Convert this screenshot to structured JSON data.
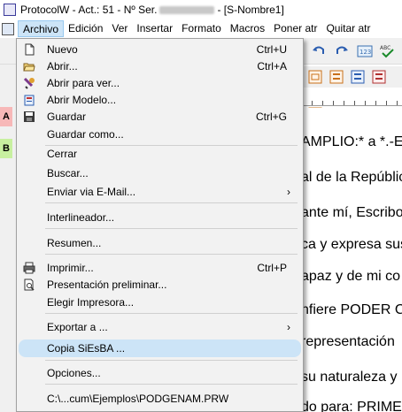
{
  "window": {
    "title_prefix": "ProtocolW - Act.: 51 - Nº Ser.",
    "title_suffix": "- [S-Nombre1]"
  },
  "menubar": {
    "items": [
      "Archivo",
      "Edición",
      "Ver",
      "Insertar",
      "Formato",
      "Macros",
      "Poner atr",
      "Quitar atr"
    ]
  },
  "left_strip": {
    "cells": [
      "A",
      "B"
    ]
  },
  "document": {
    "lines": [
      "AMPLIO:* a *.-E",
      "al de la Repúblic",
      "ante mí, Escribo",
      "ca y expresa sus",
      "apaz y de mi co",
      "nfiere PODER C",
      "representación",
      "su naturaleza y l",
      "do para: PRIME"
    ]
  },
  "file_menu": {
    "items": [
      {
        "label": "Nuevo",
        "shortcut": "Ctrl+U",
        "icon": "new-document-icon"
      },
      {
        "label": "Abrir...",
        "shortcut": "Ctrl+A",
        "icon": "open-folder-icon"
      },
      {
        "label": "Abrir para ver...",
        "shortcut": "",
        "icon": "view-icon"
      },
      {
        "label": "Abrir Modelo...",
        "shortcut": "",
        "icon": "template-icon"
      },
      {
        "label": "Guardar",
        "shortcut": "Ctrl+G",
        "icon": "save-icon"
      },
      {
        "label": "Guardar como...",
        "shortcut": ""
      },
      {
        "label": "Cerrar",
        "shortcut": ""
      },
      {
        "label": "Buscar...",
        "shortcut": ""
      },
      {
        "label": "Enviar via E-Mail...",
        "shortcut": "",
        "submenu": true
      },
      {
        "label": "Interlineador...",
        "shortcut": ""
      },
      {
        "label": "Resumen...",
        "shortcut": ""
      },
      {
        "label": "Imprimir...",
        "shortcut": "Ctrl+P",
        "icon": "printer-icon"
      },
      {
        "label": "Presentación preliminar...",
        "shortcut": "",
        "icon": "print-preview-icon"
      },
      {
        "label": "Elegir Impresora...",
        "shortcut": ""
      },
      {
        "label": "Exportar a ...",
        "shortcut": "",
        "submenu": true
      },
      {
        "label": "Copia SiEsBA ...",
        "shortcut": "",
        "highlighted": true
      },
      {
        "label": "Opciones...",
        "shortcut": ""
      },
      {
        "label": "C:\\...cum\\Ejemplos\\PODGENAM.PRW",
        "shortcut": ""
      }
    ],
    "submenu_arrow": "›"
  },
  "colors": {
    "highlight": "#cce4f7",
    "menu_bg": "#f2f2f2"
  }
}
